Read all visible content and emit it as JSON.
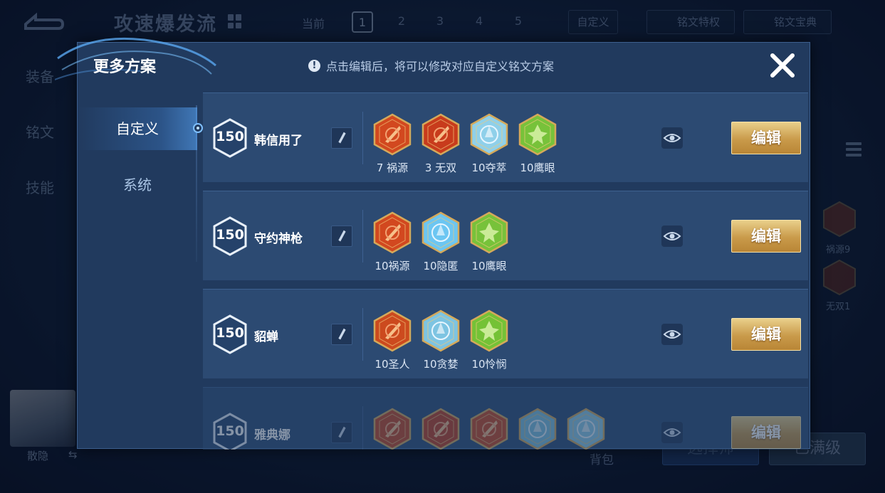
{
  "background": {
    "build_title": "攻速爆发流",
    "current_label": "当前",
    "slots": [
      "1",
      "2",
      "3",
      "4",
      "5"
    ],
    "active_slot": "1",
    "custom_button": "自定义",
    "privilege_button": "铭文特权",
    "codex_button": "铭文宝典",
    "side_tabs": [
      "装备",
      "铭文",
      "技能"
    ],
    "right_runes": [
      "祸源9",
      "无双1"
    ],
    "hero_name": "散隐",
    "backpack_label": "背包",
    "choose_button": "选择师",
    "maxed_button": "已满级"
  },
  "modal": {
    "title": "更多方案",
    "hint": "点击编辑后，将可以修改对应自定义铭文方案",
    "nav": [
      {
        "label": "自定义",
        "active": true
      },
      {
        "label": "系统",
        "active": false
      }
    ],
    "edit_label": "编辑",
    "plans": [
      {
        "level": "150",
        "name": "韩信用了",
        "runes": [
          {
            "label": "7 祸源",
            "icon": "red-rune-icon",
            "color": "#d2481f"
          },
          {
            "label": "3 无双",
            "icon": "red-rune-icon",
            "color": "#c83b1c"
          },
          {
            "label": "10夺萃",
            "icon": "blue-rune-icon",
            "color": "#8fd0ea"
          },
          {
            "label": "10鹰眼",
            "icon": "green-rune-icon",
            "color": "#77c23a"
          }
        ]
      },
      {
        "level": "150",
        "name": "守约神枪",
        "runes": [
          {
            "label": "10祸源",
            "icon": "red-rune-icon",
            "color": "#d2481f"
          },
          {
            "label": "10隐匿",
            "icon": "blue-rune-icon",
            "color": "#6cc6f2"
          },
          {
            "label": "10鹰眼",
            "icon": "green-rune-icon",
            "color": "#77c23a"
          }
        ]
      },
      {
        "level": "150",
        "name": "貂蝉",
        "runes": [
          {
            "label": "10圣人",
            "icon": "red-rune-icon",
            "color": "#cc4a1e"
          },
          {
            "label": "10贪婪",
            "icon": "blue-rune-icon",
            "color": "#7dc4e2"
          },
          {
            "label": "10怜悯",
            "icon": "green-rune-icon",
            "color": "#74c236"
          }
        ]
      },
      {
        "level": "150",
        "name": "雅典娜",
        "runes": [
          {
            "label": "",
            "icon": "red-rune-icon",
            "color": "#c8441d"
          },
          {
            "label": "",
            "icon": "red-rune-icon",
            "color": "#c23c1a"
          },
          {
            "label": "",
            "icon": "red-rune-icon",
            "color": "#cc461c"
          },
          {
            "label": "",
            "icon": "blue-rune-icon",
            "color": "#7dc4e2"
          },
          {
            "label": "",
            "icon": "blue-rune-icon",
            "color": "#8fd0ea"
          }
        ]
      }
    ]
  }
}
